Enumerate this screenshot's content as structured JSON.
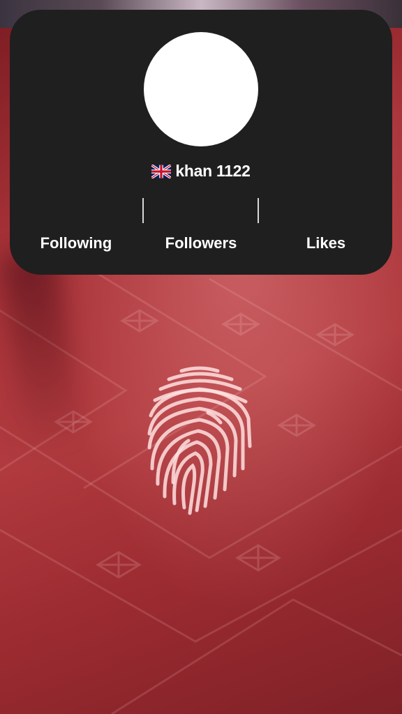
{
  "profile": {
    "username": "khan 1122",
    "flag": "uk-flag-icon"
  },
  "stats": {
    "following_label": "Following",
    "followers_label": "Followers",
    "likes_label": "Likes"
  },
  "icons": {
    "fingerprint": "fingerprint-icon"
  },
  "colors": {
    "card_background": "#1f1f1f",
    "text": "#ffffff",
    "background_red": "#a83238"
  }
}
